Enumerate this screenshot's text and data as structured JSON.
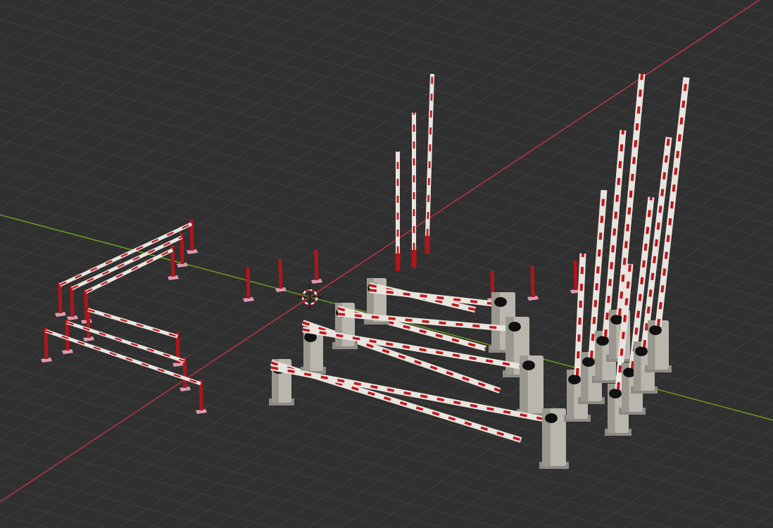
{
  "viewport": {
    "axes": [
      {
        "kind": "x",
        "color": "#b8343e"
      },
      {
        "kind": "y",
        "color": "#6b9a1e"
      }
    ]
  }
}
